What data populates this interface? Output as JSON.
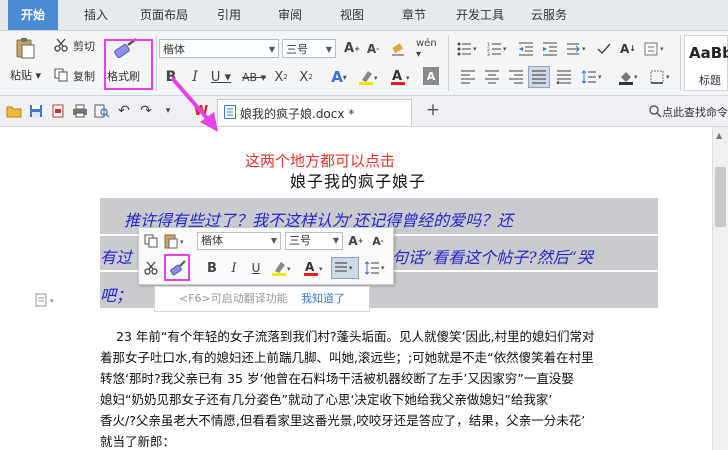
{
  "tabs": [
    "开始",
    "插入",
    "页面布局",
    "引用",
    "审阅",
    "视图",
    "章节",
    "开发工具",
    "云服务"
  ],
  "ribbon": {
    "paste_label": "粘贴",
    "cut_label": "剪切",
    "copy_label": "复制",
    "format_painter_label": "格式刷",
    "font_name": "楷体",
    "font_size": "三号",
    "style_preview": "AaBb",
    "style_label": "标题"
  },
  "quickbar": {
    "doc_tab_title": "娘我的疯子娘.docx *",
    "search_label": "点此查找命令"
  },
  "document": {
    "annotation": "这两个地方都可以点击",
    "title": "娘子我的疯子娘子",
    "sel_line1": "推许得有些过了？我不这样认为’还记得曾经的爱吗？还",
    "sel_line2_left": "有过",
    "sel_line2_right": "句话”看看这个帖子?然后“哭",
    "sel_line3": "吧；",
    "body_lines": [
      "23 年前“有个年轻的女子流落到我们村?蓬头垢面。见人就傻笑’因此,村里的媳妇们常对",
      "着那女子吐口水,有的媳妇还上前踹几脚、叫她,滚远些；;可她就是不走“依然傻笑着在村里",
      "转悠‘那时?我父亲已有 35 岁’他曾在石料场干活被机器绞断了左手’又因家穷”一直没娶",
      "媳妇“奶奶见那女子还有几分姿色”就动了心思‘决定收下她给我父亲做媳妇”给我家’",
      "香火/?父亲虽老大不情愿,但看看家里这番光景,咬咬牙还是答应了，结果，父亲一分未花’",
      "就当了新郎："
    ]
  },
  "mini_toolbar": {
    "font_name": "楷体",
    "font_size": "三号"
  },
  "tip": {
    "hint": "<F6>可启动翻译功能",
    "got_it": "我知道了"
  },
  "colors": {
    "accent": "#4a8bd6",
    "highlight_box": "#e640e6",
    "annotation": "#e8332a",
    "selected_text": "#2727c9"
  }
}
